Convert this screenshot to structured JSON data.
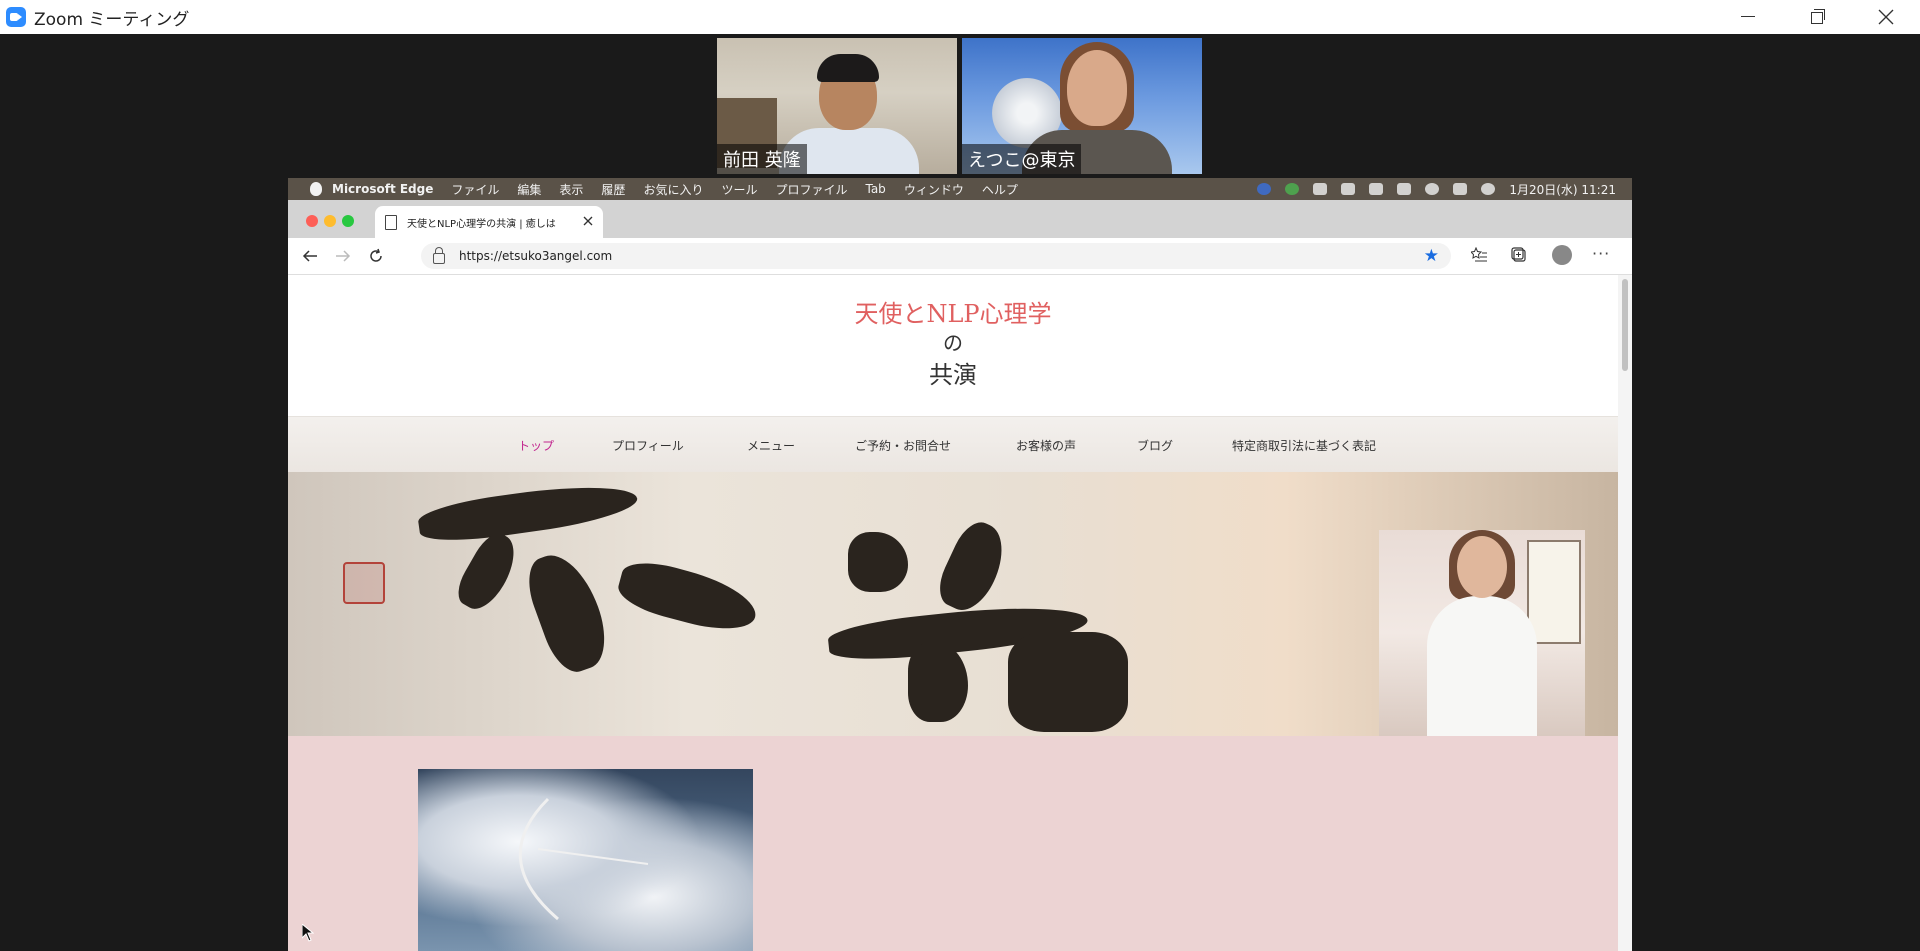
{
  "window": {
    "title": "Zoom ミーティング"
  },
  "participants": [
    {
      "name": "前田 英隆"
    },
    {
      "name": "えつこ@東京"
    }
  ],
  "mac_menubar": {
    "app": "Microsoft Edge",
    "items": [
      "ファイル",
      "編集",
      "表示",
      "履歴",
      "お気に入り",
      "ツール",
      "プロファイル",
      "Tab",
      "ウィンドウ",
      "ヘルプ"
    ],
    "clock": "1月20日(水)  11:21"
  },
  "browser": {
    "tab_title": "天使とNLP心理学の共演 | 癒しは",
    "url": "https://etsuko3angel.com"
  },
  "site": {
    "title_line1": "天使とNLP心理学",
    "title_line2": "の",
    "title_line3": "共演",
    "nav": [
      "トップ",
      "プロフィール",
      "メニュー",
      "ご予約・お問合せ",
      "お客様の声",
      "ブログ",
      "特定商取引法に基づく表記"
    ]
  },
  "colors": {
    "title_accent": "#e06060",
    "nav_active": "#c2278f",
    "section_bg": "#ecd3d3"
  }
}
